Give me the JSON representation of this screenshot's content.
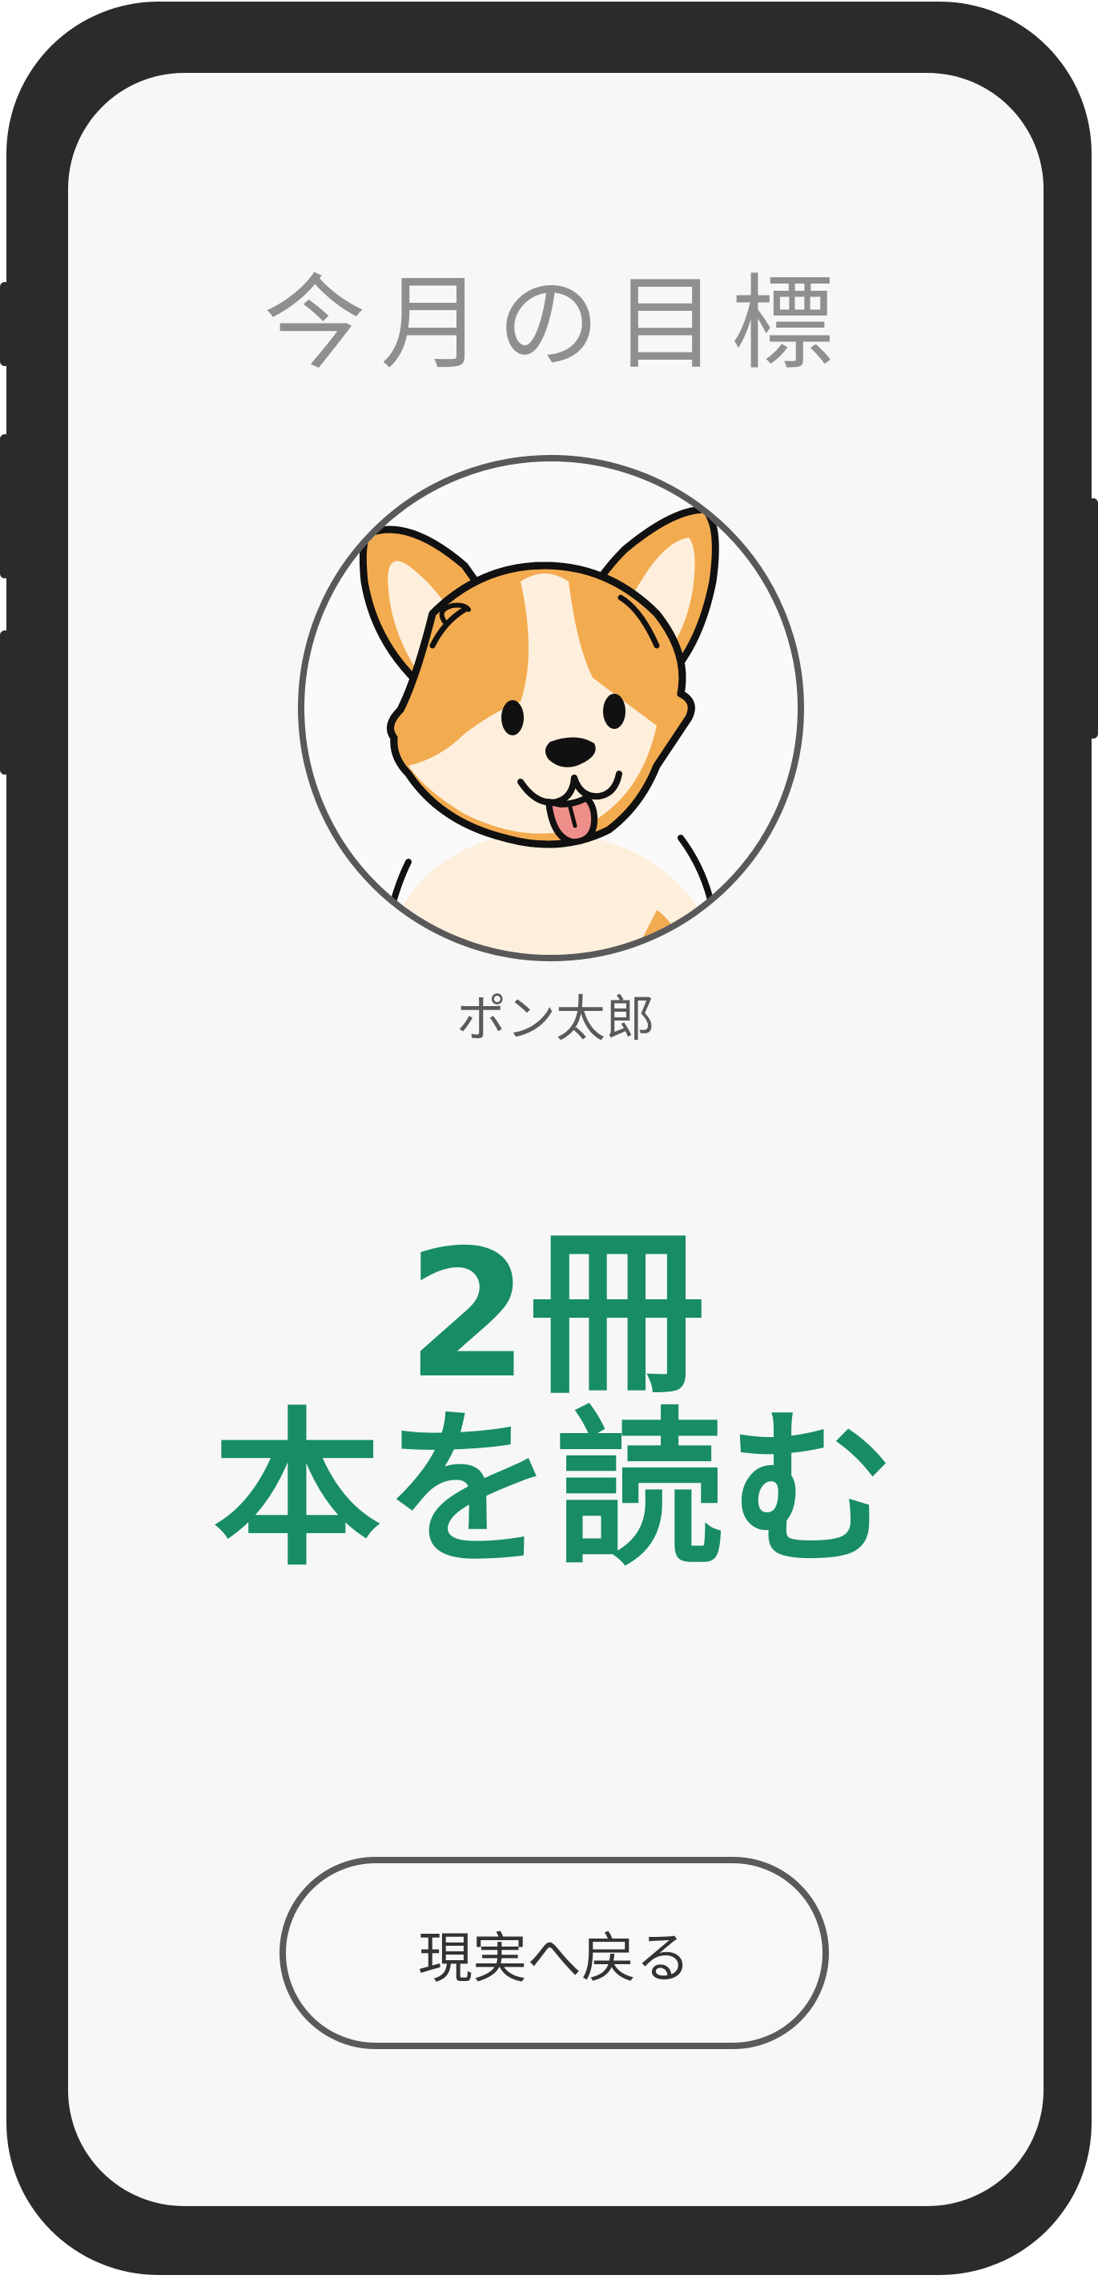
{
  "screen": {
    "title": "今月の目標",
    "pet": {
      "name": "ポン太郎",
      "avatar": "corgi-illustration"
    },
    "goal": {
      "count": "2冊",
      "action": "本を読む"
    },
    "return_button_label": "現実へ戻る"
  },
  "colors": {
    "accent": "#178c67",
    "device_frame": "#2b2b2b",
    "screen_background": "#f6f7f6",
    "corgi_orange": "#f3ab50",
    "corgi_cream": "#fdefdc",
    "tongue": "#ef8f8a"
  }
}
